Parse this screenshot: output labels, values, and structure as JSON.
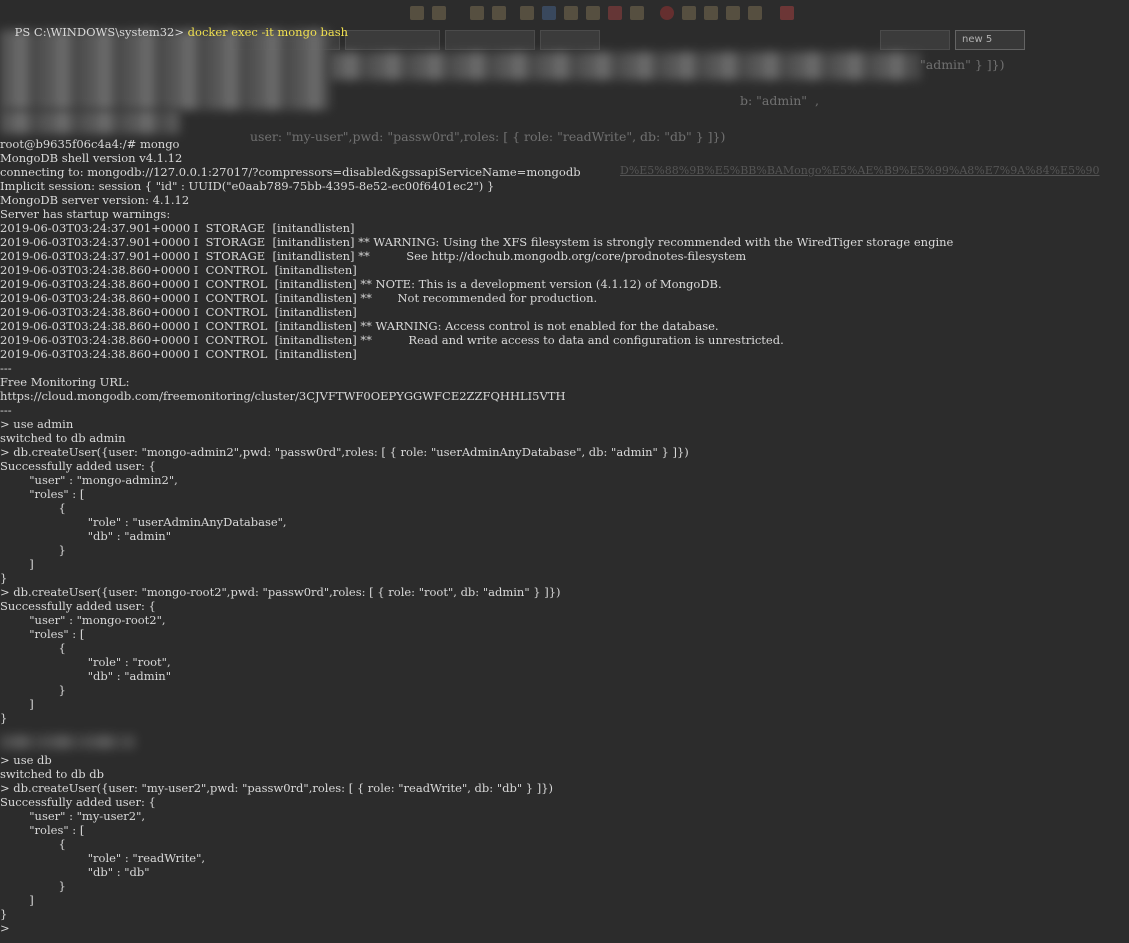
{
  "terminal": {
    "prompt": "PS C:\\WINDOWS\\system32> ",
    "first_command": "docker exec -it mongo bash",
    "ghost_overlay": {
      "admin_tail": "\"admin\" } ]})",
      "admin_mid": "b: \"admin\"  ,",
      "myuser_cmd": "user: \"my-user\",pwd: \"passw0rd\",roles: [ { role: \"readWrite\", db: \"db\" } ]})",
      "tab_new": "new 5",
      "url_tail": "D%E5%88%9B%E5%BB%BAMongo%E5%AE%B9%E5%99%A8%E7%9A%84%E5%90"
    },
    "lines": [
      "root@b9635f06c4a4:/# mongo",
      "MongoDB shell version v4.1.12",
      "connecting to: mongodb://127.0.0.1:27017/?compressors=disabled&gssapiServiceName=mongodb",
      "Implicit session: session { \"id\" : UUID(\"e0aab789-75bb-4395-8e52-ec00f6401ec2\") }",
      "MongoDB server version: 4.1.12",
      "Server has startup warnings:",
      "2019-06-03T03:24:37.901+0000 I  STORAGE  [initandlisten]",
      "2019-06-03T03:24:37.901+0000 I  STORAGE  [initandlisten] ** WARNING: Using the XFS filesystem is strongly recommended with the WiredTiger storage engine",
      "2019-06-03T03:24:37.901+0000 I  STORAGE  [initandlisten] **          See http://dochub.mongodb.org/core/prodnotes-filesystem",
      "2019-06-03T03:24:38.860+0000 I  CONTROL  [initandlisten]",
      "2019-06-03T03:24:38.860+0000 I  CONTROL  [initandlisten] ** NOTE: This is a development version (4.1.12) of MongoDB.",
      "2019-06-03T03:24:38.860+0000 I  CONTROL  [initandlisten] **       Not recommended for production.",
      "2019-06-03T03:24:38.860+0000 I  CONTROL  [initandlisten]",
      "2019-06-03T03:24:38.860+0000 I  CONTROL  [initandlisten] ** WARNING: Access control is not enabled for the database.",
      "2019-06-03T03:24:38.860+0000 I  CONTROL  [initandlisten] **          Read and write access to data and configuration is unrestricted.",
      "2019-06-03T03:24:38.860+0000 I  CONTROL  [initandlisten]",
      "---",
      "Free Monitoring URL:",
      "https://cloud.mongodb.com/freemonitoring/cluster/3CJVFTWF0OEPYGGWFCE2ZZFQHHLI5VTH",
      "---",
      "> use admin",
      "switched to db admin",
      "> db.createUser({user: \"mongo-admin2\",pwd: \"passw0rd\",roles: [ { role: \"userAdminAnyDatabase\", db: \"admin\" } ]})",
      "Successfully added user: {",
      "        \"user\" : \"mongo-admin2\",",
      "        \"roles\" : [",
      "                {",
      "                        \"role\" : \"userAdminAnyDatabase\",",
      "                        \"db\" : \"admin\"",
      "                }",
      "        ]",
      "}",
      "> db.createUser({user: \"mongo-root2\",pwd: \"passw0rd\",roles: [ { role: \"root\", db: \"admin\" } ]})",
      "Successfully added user: {",
      "        \"user\" : \"mongo-root2\",",
      "        \"roles\" : [",
      "                {",
      "                        \"role\" : \"root\",",
      "                        \"db\" : \"admin\"",
      "                }",
      "        ]",
      "}",
      "",
      "",
      "> use db",
      "switched to db db",
      "> db.createUser({user: \"my-user2\",pwd: \"passw0rd\",roles: [ { role: \"readWrite\", db: \"db\" } ]})",
      "Successfully added user: {",
      "        \"user\" : \"my-user2\",",
      "        \"roles\" : [",
      "                {",
      "                        \"role\" : \"readWrite\",",
      "                        \"db\" : \"db\"",
      "                }",
      "        ]",
      "}",
      ">"
    ]
  }
}
